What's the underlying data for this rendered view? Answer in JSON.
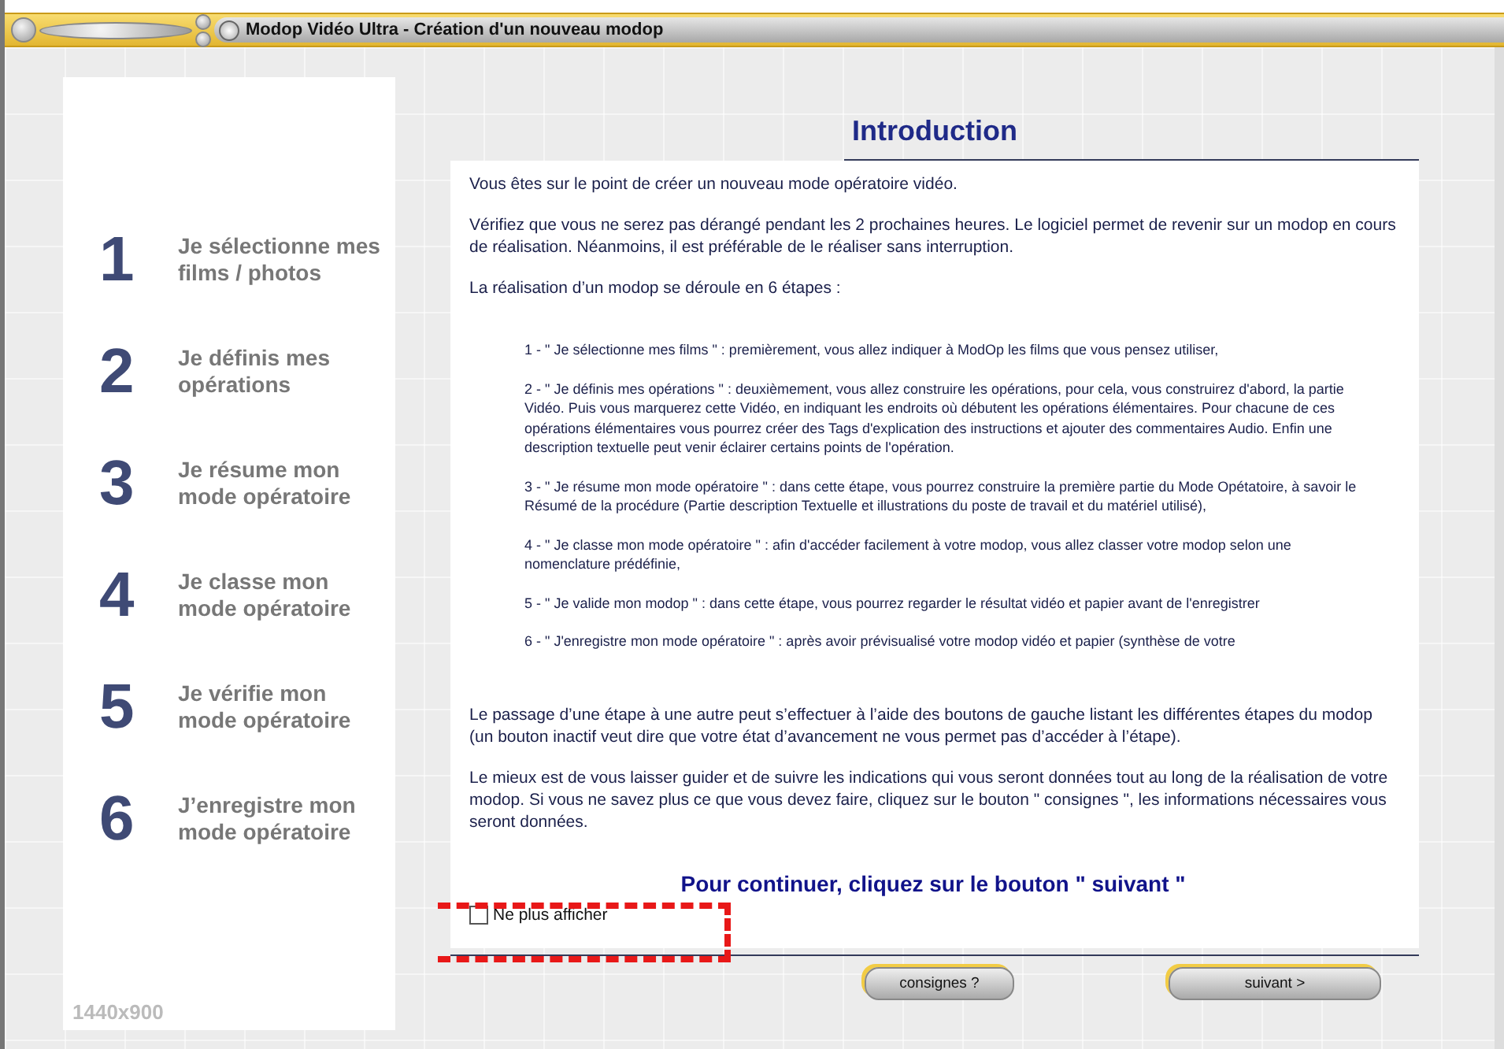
{
  "window": {
    "title": "Modop Vidéo Ultra - Création d'un nouveau modop"
  },
  "steps": [
    {
      "number": "1",
      "label": "Je sélectionne mes films / photos"
    },
    {
      "number": "2",
      "label": "Je définis mes opérations"
    },
    {
      "number": "3",
      "label": "Je résume mon mode opératoire"
    },
    {
      "number": "4",
      "label": "Je classe mon mode opératoire"
    },
    {
      "number": "5",
      "label": "Je vérifie mon mode opératoire"
    },
    {
      "number": "6",
      "label": "J’enregistre mon mode opératoire"
    }
  ],
  "resolution": "1440x900",
  "heading": "Introduction",
  "intro_paragraphs": [
    "Vous êtes sur le point de créer un nouveau mode opératoire vidéo.",
    "Vérifiez que vous ne serez pas dérangé pendant les 2 prochaines heures. Le logiciel permet de revenir sur un modop en cours de réalisation. Néanmoins, il est préférable de le réaliser sans interruption.",
    "La réalisation d’un modop se déroule en 6 étapes :"
  ],
  "step_descriptions": [
    "1 - \" Je sélectionne mes films \" : premièrement, vous allez indiquer à ModOp les films que vous pensez utiliser,",
    "2 - \" Je définis mes opérations \" : deuxièmement, vous allez construire les opérations, pour cela, vous construirez d'abord, la partie Vidéo. Puis vous marquerez cette Vidéo, en indiquant les endroits où débutent les opérations élémentaires. Pour chacune de ces opérations élémentaires vous pourrez créer des Tags d'explication des instructions et ajouter des commentaires Audio. Enfin une description textuelle peut venir éclairer certains points de l'opération.",
    "3 - \" Je résume mon mode opératoire \" : dans cette étape, vous pourrez construire la première partie du Mode Opétatoire, à savoir le Résumé de la procédure (Partie description Textuelle et illustrations du poste de travail et du matériel utilisé),",
    "4 - \" Je classe mon mode opératoire \" : afin d'accéder facilement à votre modop, vous allez classer votre modop selon une nomenclature prédéfinie,",
    "5 - \" Je valide mon modop \" : dans cette étape, vous pourrez regarder le résultat vidéo et papier avant de l'enregistrer",
    "6 - \" J'enregistre mon mode opératoire \" : après avoir prévisualisé votre modop vidéo et papier (synthèse de votre"
  ],
  "outro_paragraphs": [
    "Le passage d’une étape à une autre peut s’effectuer à l’aide des boutons de gauche listant les différentes étapes du modop (un bouton inactif veut dire que votre état d’avancement ne vous permet pas d’accéder à l’étape).",
    "Le mieux est de vous laisser guider et de suivre les indications qui vous seront données tout au long de la réalisation de votre modop. Si vous ne savez plus ce que vous devez faire, cliquez sur le bouton \" consignes \", les informations nécessaires vous seront données."
  ],
  "call_to_action": "Pour continuer, cliquez sur le bouton \" suivant \"",
  "dont_show_again": {
    "label": "Ne plus afficher",
    "checked": false
  },
  "buttons": [
    {
      "label": "consignes ?"
    },
    {
      "label": "suivant >"
    }
  ]
}
